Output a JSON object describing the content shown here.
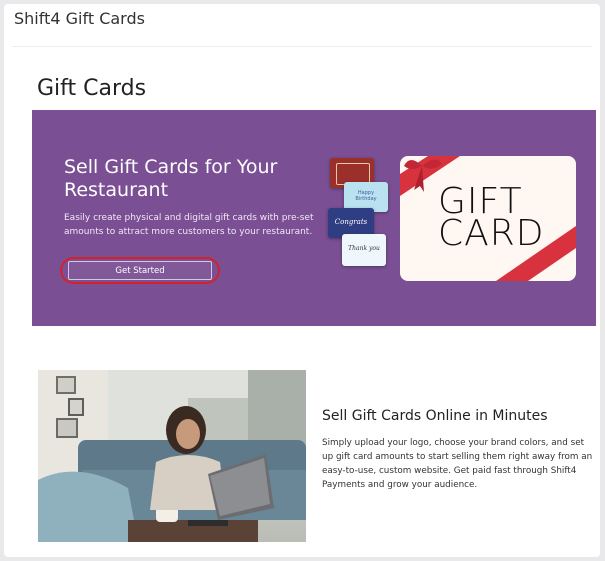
{
  "app": {
    "title": "Shift4 Gift Cards"
  },
  "page": {
    "title": "Gift Cards"
  },
  "hero": {
    "title": "Sell Gift Cards for Your Restaurant",
    "description": "Easily create physical and digital gift cards with pre-set amounts to attract more customers to your restaurant.",
    "cta_label": "Get Started",
    "big_card_text": "GIFT CARD",
    "mini_cards": [
      "Happy Birthday",
      "Congrats",
      "Thank you"
    ]
  },
  "section": {
    "title": "Sell Gift Cards Online in Minutes",
    "description": "Simply upload your logo, choose your brand colors, and set up gift card amounts to start selling them right away from an easy-to-use, custom website. Get paid fast through Shift4 Payments and grow your audience."
  },
  "colors": {
    "hero_bg": "#7a4f93",
    "ribbon": "#d9323f",
    "highlight": "#d2232a"
  }
}
